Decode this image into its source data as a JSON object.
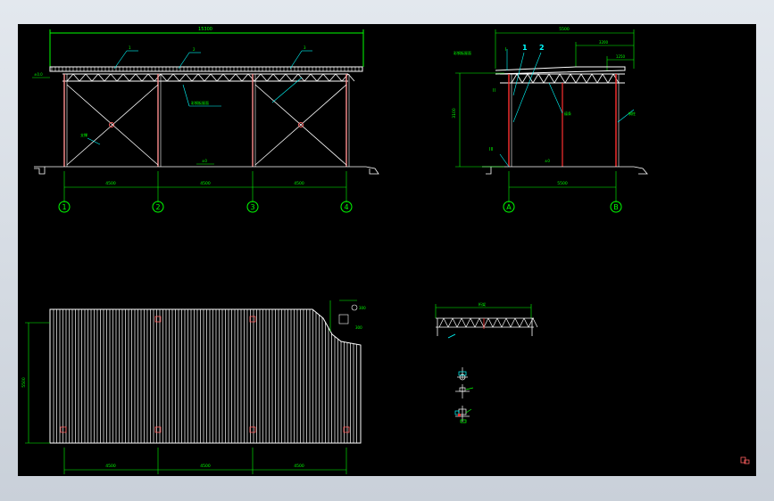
{
  "drawing": {
    "front_elevation": {
      "overall_dim": "15300",
      "bay_dims": [
        "4500",
        "4500",
        "4500"
      ],
      "axis_labels": [
        "1",
        "2",
        "3",
        "4"
      ],
      "leader_tags": [
        "1",
        "2",
        "3",
        "4"
      ],
      "level_left": "±0.0",
      "ground_level": "±0",
      "roof_note": "彩钢板屋面",
      "brace_note": "支撑"
    },
    "side_elevation": {
      "overall_dim": "5500",
      "top_dim_a": "3200",
      "top_dim_b": "1250",
      "height_dim": "3100",
      "span_dim": "5500",
      "axis_labels": [
        "A",
        "B"
      ],
      "node_labels": [
        "I",
        "II",
        "III"
      ],
      "callouts": [
        "1",
        "2"
      ],
      "ground_level": "±0",
      "note_left": "彩钢板屋面",
      "note_right": "钢柱",
      "note_mid": "檩条"
    },
    "plan": {
      "height_dim": "5500",
      "bay_dims": [
        "4500",
        "4500",
        "4500"
      ],
      "detail_dim_a": "300",
      "detail_dim_b": "300"
    },
    "truss_detail": {
      "label": "桁架"
    },
    "corner_icon": "model-space-icon"
  },
  "colors": {
    "background": "#000000",
    "line": "#ffffff",
    "dimension": "#00ff00",
    "leader": "#00ffff",
    "column": "#ff3030",
    "annotation_green": "#00ff00"
  }
}
